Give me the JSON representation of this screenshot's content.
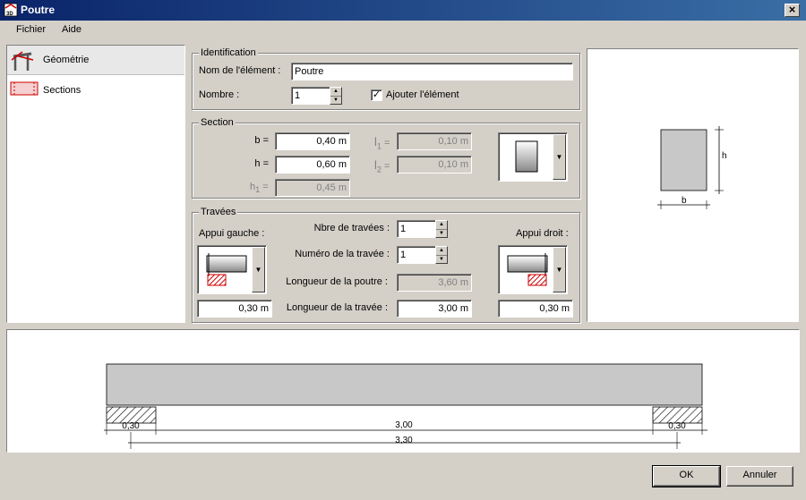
{
  "window": {
    "title": "Poutre",
    "close_glyph": "×",
    "app_icon_text": "3D"
  },
  "menu": [
    "Fichier",
    "Aide"
  ],
  "nav": [
    {
      "label": "Géométrie",
      "icon": "frame-geometry-icon",
      "selected": true
    },
    {
      "label": "Sections",
      "icon": "section-rect-icon",
      "selected": false
    }
  ],
  "identification": {
    "title": "Identification",
    "name_label": "Nom de l'élément :",
    "name_value": "Poutre",
    "count_label": "Nombre :",
    "count_value": "1",
    "add_label": "Ajouter l'élément",
    "add_checked": true,
    "check_glyph": "✓"
  },
  "section": {
    "title": "Section",
    "b_label": "b =",
    "b_value": "0,40 m",
    "h_label": "h =",
    "h_value": "0,60 m",
    "h1_label": "h",
    "h1_sub": "1",
    "h1_eq": " =",
    "h1_value": "0,45 m",
    "l1_label": "l",
    "l1_sub": "1",
    "l1_eq": " =",
    "l1_value": "0,10 m",
    "l2_label": "l",
    "l2_sub": "2",
    "l2_eq": " =",
    "l2_value": "0,10 m"
  },
  "travees": {
    "title": "Travées",
    "left_support_label": "Appui gauche :",
    "right_support_label": "Appui droit :",
    "left_support_value": "0,30 m",
    "right_support_value": "0,30 m",
    "nb_label": "Nbre de travées :",
    "nb_value": "1",
    "num_label": "Numéro de la travée :",
    "num_value": "1",
    "beam_len_label": "Longueur de la poutre :",
    "beam_len_value": "3,60 m",
    "span_len_label": "Longueur de la travée :",
    "span_len_value": "3,00 m"
  },
  "preview": {
    "h_label": "h",
    "b_label": "b"
  },
  "elevation": {
    "left_support": "0,30",
    "right_support": "0,30",
    "span": "3,00",
    "total": "3,30"
  },
  "buttons": {
    "ok": "OK",
    "cancel": "Annuler"
  },
  "colors": {
    "title_start": "#0a246a",
    "title_end": "#3a6ea5",
    "beam": "#c8c8c8",
    "support_red": "#cc0000"
  }
}
